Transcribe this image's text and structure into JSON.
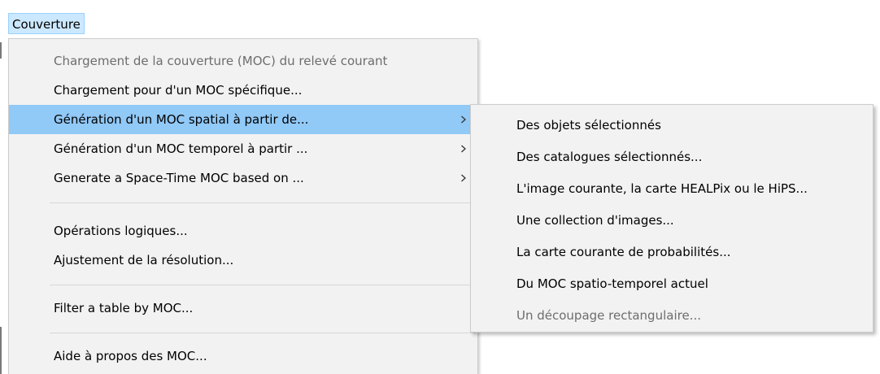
{
  "menubar": {
    "title": "Couverture"
  },
  "main_menu": {
    "items": [
      {
        "label": "Chargement de la couverture (MOC) du relevé courant",
        "disabled": true
      },
      {
        "label": "Chargement pour d'un MOC spécifique..."
      },
      {
        "label": "Génération d'un MOC spatial à partir de...",
        "submenu": true,
        "highlighted": true
      },
      {
        "label": "Génération d'un MOC temporel à partir ...",
        "submenu": true
      },
      {
        "label": "Generate a Space-Time MOC based on ...",
        "submenu": true
      },
      {
        "label": "Opérations logiques..."
      },
      {
        "label": "Ajustement de la résolution..."
      },
      {
        "label": "Filter a table by MOC..."
      },
      {
        "label": "Aide à propos des MOC..."
      }
    ]
  },
  "sub_menu": {
    "items": [
      {
        "label": "Des objets sélectionnés"
      },
      {
        "label": "Des catalogues sélectionnés..."
      },
      {
        "label": "L'image courante, la carte HEALPix ou le HiPS..."
      },
      {
        "label": "Une collection d'images..."
      },
      {
        "label": "La carte courante de probabilités..."
      },
      {
        "label": "Du MOC spatio-temporel actuel"
      },
      {
        "label": "Un découpage rectangulaire...",
        "disabled": true
      }
    ]
  },
  "colors": {
    "menu_bg": "#f2f2f2",
    "highlight": "#91c9f7",
    "menubar_selected": "#cce8ff",
    "disabled_text": "#6d6d6d"
  },
  "icons": {
    "submenu_arrow": "chevron-right-icon"
  }
}
